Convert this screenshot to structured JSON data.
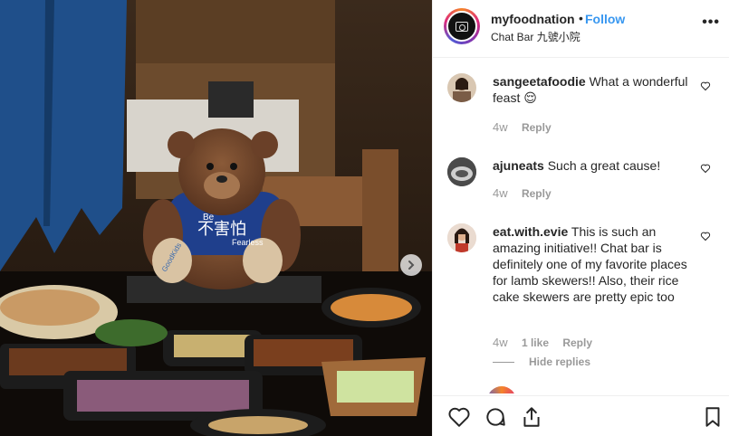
{
  "post": {
    "username": "myfoodnation",
    "separator": "•",
    "follow_label": "Follow",
    "location": "Chat Bar 九號小院",
    "more_label": "•••",
    "bear_shirt_text_top": "Be",
    "bear_shirt_text_cn": "不害怕",
    "bear_shirt_text_bottom": "Fearless",
    "bear_paw_text": "GoodKids"
  },
  "comments": [
    {
      "username": "sangeetafoodie",
      "text": "What a wonderful feast 😌",
      "time": "4w",
      "actions": [
        "Reply"
      ]
    },
    {
      "username": "ajuneats",
      "text": "Such a great cause!",
      "time": "4w",
      "actions": [
        "Reply"
      ]
    },
    {
      "username": "eat.with.evie",
      "text": "This is such an amazing initiative!! Chat bar is definitely one of my favorite places for lamb skewers!! Also, their rice cake skewers are pretty epic too",
      "time": "4w",
      "actions": [
        "1 like",
        "Reply"
      ]
    }
  ],
  "hide_replies_label": "Hide replies",
  "colors": {
    "follow": "#3897f0",
    "meta": "#999999",
    "text": "#262626",
    "divider": "#efefef"
  },
  "icons": {
    "like": "heart-icon",
    "comment": "comment-icon",
    "share": "share-icon",
    "save": "bookmark-icon",
    "next": "chevron-right-icon",
    "comment_like": "heart-icon"
  }
}
